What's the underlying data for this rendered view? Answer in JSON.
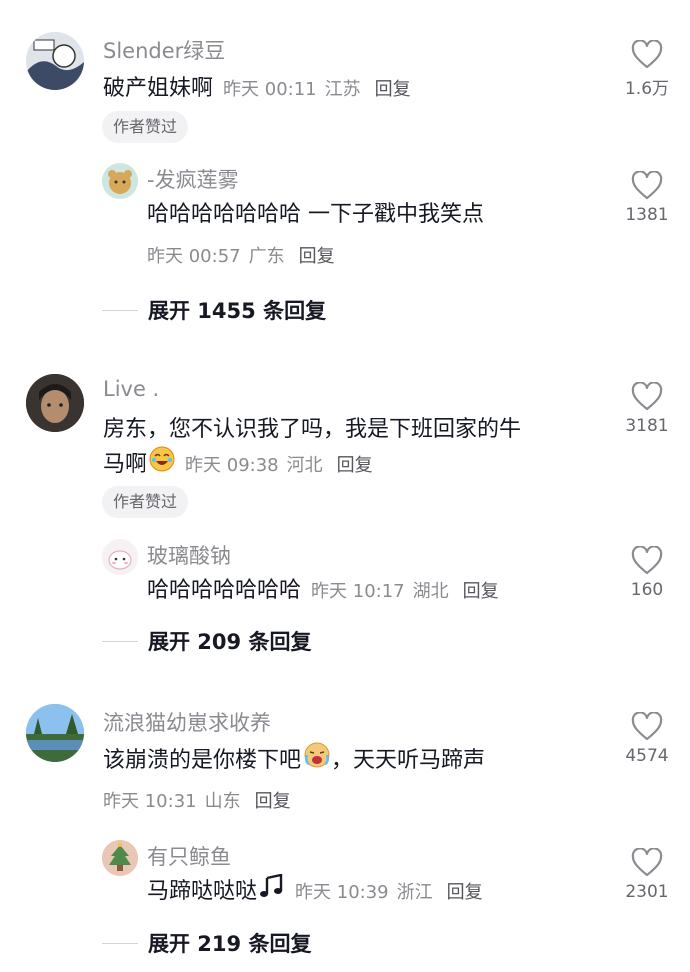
{
  "comments": [
    {
      "username": "Slender绿豆",
      "text": "破产姐妹啊",
      "time": "昨天 00:11",
      "location": "江苏",
      "reply_label": "回复",
      "badge": "作者赞过",
      "likes": "1.6万",
      "sub_reply": {
        "username": "-发疯莲雾",
        "text": "哈哈哈哈哈哈哈 一下子戳中我笑点",
        "time": "昨天 00:57",
        "location": "广东",
        "reply_label": "回复",
        "likes": "1381"
      },
      "expand_label": "展开 1455 条回复"
    },
    {
      "username": "Live .",
      "text_line1": "房东，您不认识我了吗，我是下班回家的牛",
      "text_line2": "马啊",
      "time": "昨天 09:38",
      "location": "河北",
      "reply_label": "回复",
      "badge": "作者赞过",
      "likes": "3181",
      "sub_reply": {
        "username": "玻璃酸钠",
        "text": "哈哈哈哈哈哈哈",
        "time": "昨天 10:17",
        "location": "湖北",
        "reply_label": "回复",
        "likes": "160"
      },
      "expand_label": "展开 209 条回复"
    },
    {
      "username": "流浪猫幼崽求收养",
      "text_part1": "该崩溃的是你楼下吧",
      "text_part2": "，天天听马蹄声",
      "time": "昨天 10:31",
      "location": "山东",
      "reply_label": "回复",
      "likes": "4574",
      "sub_reply": {
        "username": "有只鲸鱼",
        "text": "马蹄哒哒哒",
        "time": "昨天 10:39",
        "location": "浙江",
        "reply_label": "回复",
        "likes": "2301"
      },
      "expand_label": "展开 219 条回复"
    }
  ]
}
